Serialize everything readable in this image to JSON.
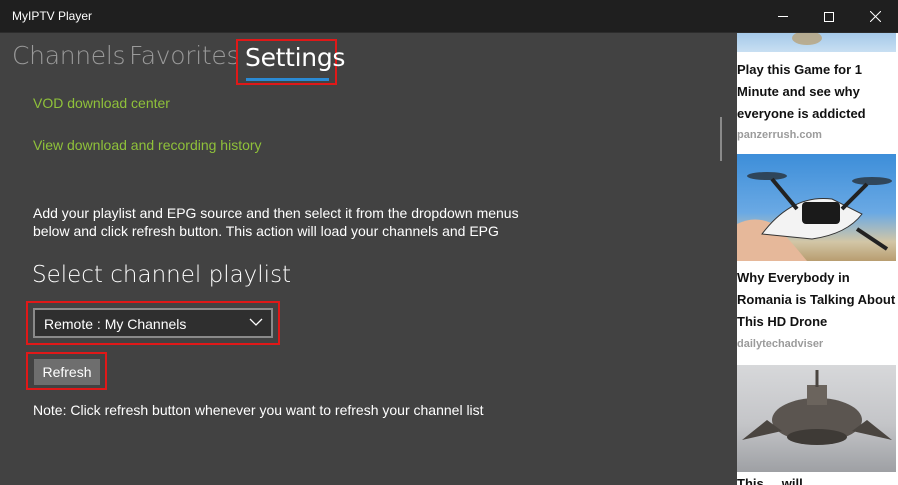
{
  "window": {
    "title": "MyIPTV Player"
  },
  "tabs": [
    {
      "label": "Channels"
    },
    {
      "label": "Favorites"
    },
    {
      "label": "Settings"
    }
  ],
  "settings": {
    "vod_link": "VOD download center",
    "history_link": "View download and recording history",
    "description_line1": "Add your playlist and EPG source and then select it from the dropdown menus",
    "description_line2": "below and click refresh button. This action will load your channels and EPG",
    "section_title": "Select channel playlist",
    "playlist_selected": "Remote : My Channels",
    "refresh_label": "Refresh",
    "note": "Note: Click refresh button whenever you want to refresh your channel list"
  },
  "ads": [
    {
      "title_lines": [
        "Play this Game for 1",
        "Minute and see why",
        "everyone is addicted"
      ],
      "source": "panzerrush.com"
    },
    {
      "title_lines": [
        "Why Everybody in",
        "Romania is Talking About",
        "This HD Drone"
      ],
      "source": "dailytechadviser"
    },
    {
      "title_lines": [
        "This ... will ... ..."
      ]
    }
  ],
  "colors": {
    "accent": "#2a8ad4",
    "link": "#8fc13a",
    "highlight": "#e01818"
  }
}
